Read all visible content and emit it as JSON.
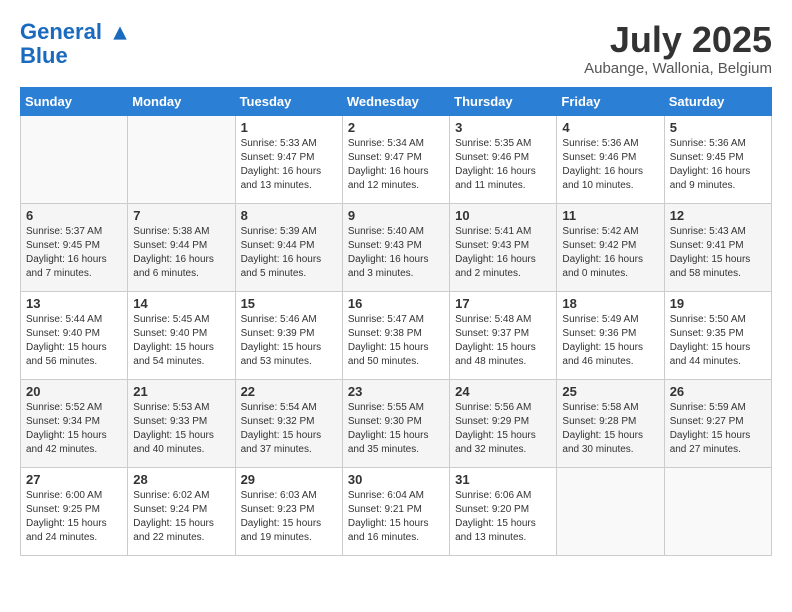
{
  "header": {
    "logo_line1": "General",
    "logo_line2": "Blue",
    "month_title": "July 2025",
    "subtitle": "Aubange, Wallonia, Belgium"
  },
  "days_of_week": [
    "Sunday",
    "Monday",
    "Tuesday",
    "Wednesday",
    "Thursday",
    "Friday",
    "Saturday"
  ],
  "weeks": [
    [
      {
        "day": "",
        "info": ""
      },
      {
        "day": "",
        "info": ""
      },
      {
        "day": "1",
        "info": "Sunrise: 5:33 AM\nSunset: 9:47 PM\nDaylight: 16 hours\nand 13 minutes."
      },
      {
        "day": "2",
        "info": "Sunrise: 5:34 AM\nSunset: 9:47 PM\nDaylight: 16 hours\nand 12 minutes."
      },
      {
        "day": "3",
        "info": "Sunrise: 5:35 AM\nSunset: 9:46 PM\nDaylight: 16 hours\nand 11 minutes."
      },
      {
        "day": "4",
        "info": "Sunrise: 5:36 AM\nSunset: 9:46 PM\nDaylight: 16 hours\nand 10 minutes."
      },
      {
        "day": "5",
        "info": "Sunrise: 5:36 AM\nSunset: 9:45 PM\nDaylight: 16 hours\nand 9 minutes."
      }
    ],
    [
      {
        "day": "6",
        "info": "Sunrise: 5:37 AM\nSunset: 9:45 PM\nDaylight: 16 hours\nand 7 minutes."
      },
      {
        "day": "7",
        "info": "Sunrise: 5:38 AM\nSunset: 9:44 PM\nDaylight: 16 hours\nand 6 minutes."
      },
      {
        "day": "8",
        "info": "Sunrise: 5:39 AM\nSunset: 9:44 PM\nDaylight: 16 hours\nand 5 minutes."
      },
      {
        "day": "9",
        "info": "Sunrise: 5:40 AM\nSunset: 9:43 PM\nDaylight: 16 hours\nand 3 minutes."
      },
      {
        "day": "10",
        "info": "Sunrise: 5:41 AM\nSunset: 9:43 PM\nDaylight: 16 hours\nand 2 minutes."
      },
      {
        "day": "11",
        "info": "Sunrise: 5:42 AM\nSunset: 9:42 PM\nDaylight: 16 hours\nand 0 minutes."
      },
      {
        "day": "12",
        "info": "Sunrise: 5:43 AM\nSunset: 9:41 PM\nDaylight: 15 hours\nand 58 minutes."
      }
    ],
    [
      {
        "day": "13",
        "info": "Sunrise: 5:44 AM\nSunset: 9:40 PM\nDaylight: 15 hours\nand 56 minutes."
      },
      {
        "day": "14",
        "info": "Sunrise: 5:45 AM\nSunset: 9:40 PM\nDaylight: 15 hours\nand 54 minutes."
      },
      {
        "day": "15",
        "info": "Sunrise: 5:46 AM\nSunset: 9:39 PM\nDaylight: 15 hours\nand 53 minutes."
      },
      {
        "day": "16",
        "info": "Sunrise: 5:47 AM\nSunset: 9:38 PM\nDaylight: 15 hours\nand 50 minutes."
      },
      {
        "day": "17",
        "info": "Sunrise: 5:48 AM\nSunset: 9:37 PM\nDaylight: 15 hours\nand 48 minutes."
      },
      {
        "day": "18",
        "info": "Sunrise: 5:49 AM\nSunset: 9:36 PM\nDaylight: 15 hours\nand 46 minutes."
      },
      {
        "day": "19",
        "info": "Sunrise: 5:50 AM\nSunset: 9:35 PM\nDaylight: 15 hours\nand 44 minutes."
      }
    ],
    [
      {
        "day": "20",
        "info": "Sunrise: 5:52 AM\nSunset: 9:34 PM\nDaylight: 15 hours\nand 42 minutes."
      },
      {
        "day": "21",
        "info": "Sunrise: 5:53 AM\nSunset: 9:33 PM\nDaylight: 15 hours\nand 40 minutes."
      },
      {
        "day": "22",
        "info": "Sunrise: 5:54 AM\nSunset: 9:32 PM\nDaylight: 15 hours\nand 37 minutes."
      },
      {
        "day": "23",
        "info": "Sunrise: 5:55 AM\nSunset: 9:30 PM\nDaylight: 15 hours\nand 35 minutes."
      },
      {
        "day": "24",
        "info": "Sunrise: 5:56 AM\nSunset: 9:29 PM\nDaylight: 15 hours\nand 32 minutes."
      },
      {
        "day": "25",
        "info": "Sunrise: 5:58 AM\nSunset: 9:28 PM\nDaylight: 15 hours\nand 30 minutes."
      },
      {
        "day": "26",
        "info": "Sunrise: 5:59 AM\nSunset: 9:27 PM\nDaylight: 15 hours\nand 27 minutes."
      }
    ],
    [
      {
        "day": "27",
        "info": "Sunrise: 6:00 AM\nSunset: 9:25 PM\nDaylight: 15 hours\nand 24 minutes."
      },
      {
        "day": "28",
        "info": "Sunrise: 6:02 AM\nSunset: 9:24 PM\nDaylight: 15 hours\nand 22 minutes."
      },
      {
        "day": "29",
        "info": "Sunrise: 6:03 AM\nSunset: 9:23 PM\nDaylight: 15 hours\nand 19 minutes."
      },
      {
        "day": "30",
        "info": "Sunrise: 6:04 AM\nSunset: 9:21 PM\nDaylight: 15 hours\nand 16 minutes."
      },
      {
        "day": "31",
        "info": "Sunrise: 6:06 AM\nSunset: 9:20 PM\nDaylight: 15 hours\nand 13 minutes."
      },
      {
        "day": "",
        "info": ""
      },
      {
        "day": "",
        "info": ""
      }
    ]
  ]
}
